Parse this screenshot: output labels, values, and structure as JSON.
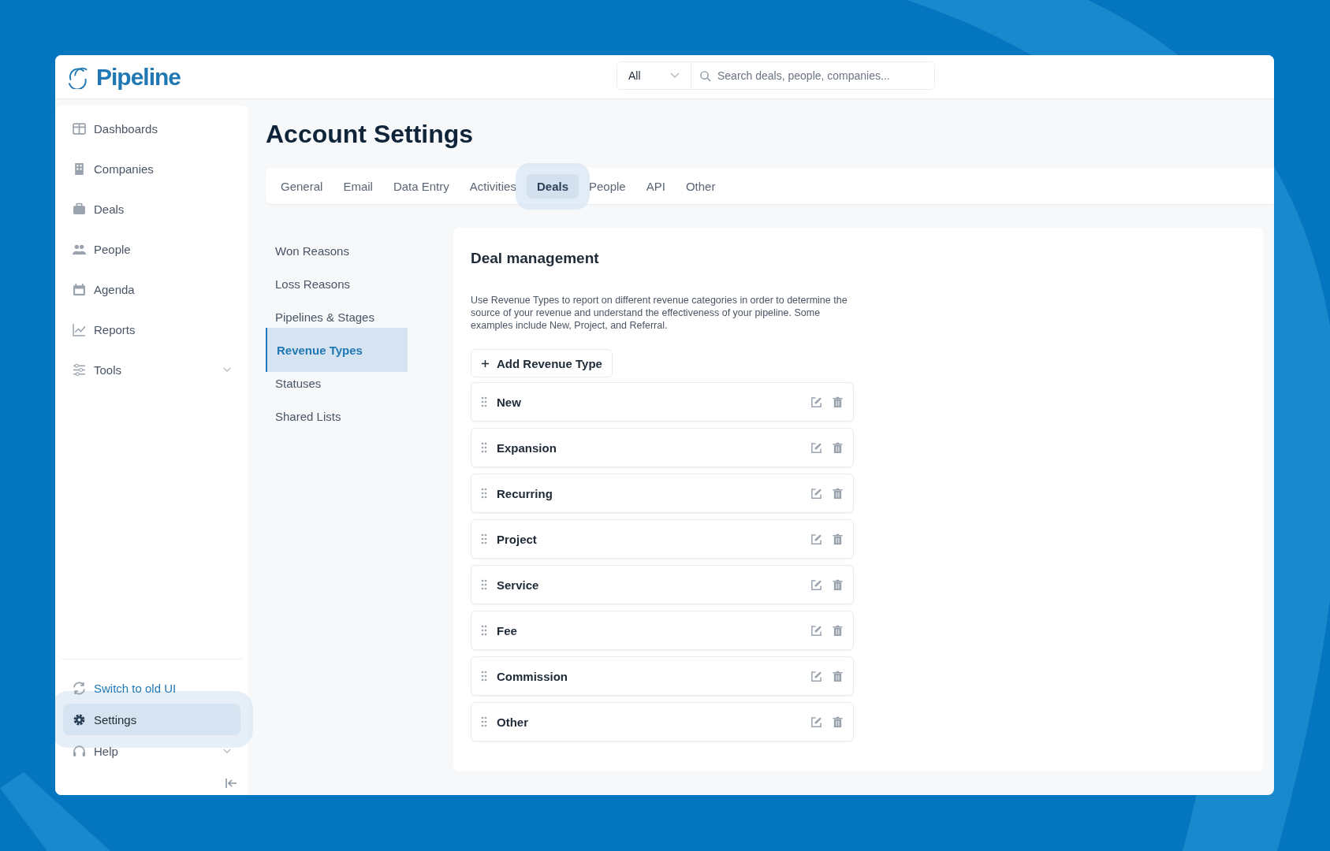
{
  "app": {
    "name": "Pipeline"
  },
  "search": {
    "scope": "All",
    "placeholder": "Search deals, people, companies..."
  },
  "sidebar": {
    "items": [
      {
        "label": "Dashboards",
        "selected": false,
        "expandable": false
      },
      {
        "label": "Companies",
        "selected": false,
        "expandable": false
      },
      {
        "label": "Deals",
        "selected": false,
        "expandable": false
      },
      {
        "label": "People",
        "selected": false,
        "expandable": false
      },
      {
        "label": "Agenda",
        "selected": false,
        "expandable": false
      },
      {
        "label": "Reports",
        "selected": false,
        "expandable": false
      },
      {
        "label": "Tools",
        "selected": false,
        "expandable": true
      }
    ],
    "bottom_items": [
      {
        "label": "Switch to old UI",
        "kind": "link",
        "selected": false,
        "expandable": false
      },
      {
        "label": "Settings",
        "kind": "item",
        "selected": true,
        "expandable": false
      },
      {
        "label": "Help",
        "kind": "item",
        "selected": false,
        "expandable": true
      }
    ]
  },
  "page": {
    "title": "Account Settings"
  },
  "tabs": [
    {
      "label": "General",
      "selected": false
    },
    {
      "label": "Email",
      "selected": false
    },
    {
      "label": "Data Entry",
      "selected": false
    },
    {
      "label": "Activities",
      "selected": false
    },
    {
      "label": "Deals",
      "selected": true
    },
    {
      "label": "People",
      "selected": false
    },
    {
      "label": "API",
      "selected": false
    },
    {
      "label": "Other",
      "selected": false
    }
  ],
  "submenu": [
    {
      "label": "Won Reasons",
      "selected": false
    },
    {
      "label": "Loss Reasons",
      "selected": false
    },
    {
      "label": "Pipelines & Stages",
      "selected": false
    },
    {
      "label": "Revenue Types",
      "selected": true
    },
    {
      "label": "Statuses",
      "selected": false
    },
    {
      "label": "Shared Lists",
      "selected": false
    }
  ],
  "panel": {
    "title": "Deal management",
    "description": "Use Revenue Types to report on different revenue categories in order to determine the source of your revenue and understand the effectiveness of your pipeline. Some examples include New, Project, and Referral.",
    "add_button": "Add Revenue Type",
    "items": [
      "New",
      "Expansion",
      "Recurring",
      "Project",
      "Service",
      "Fee",
      "Commission",
      "Other"
    ]
  }
}
